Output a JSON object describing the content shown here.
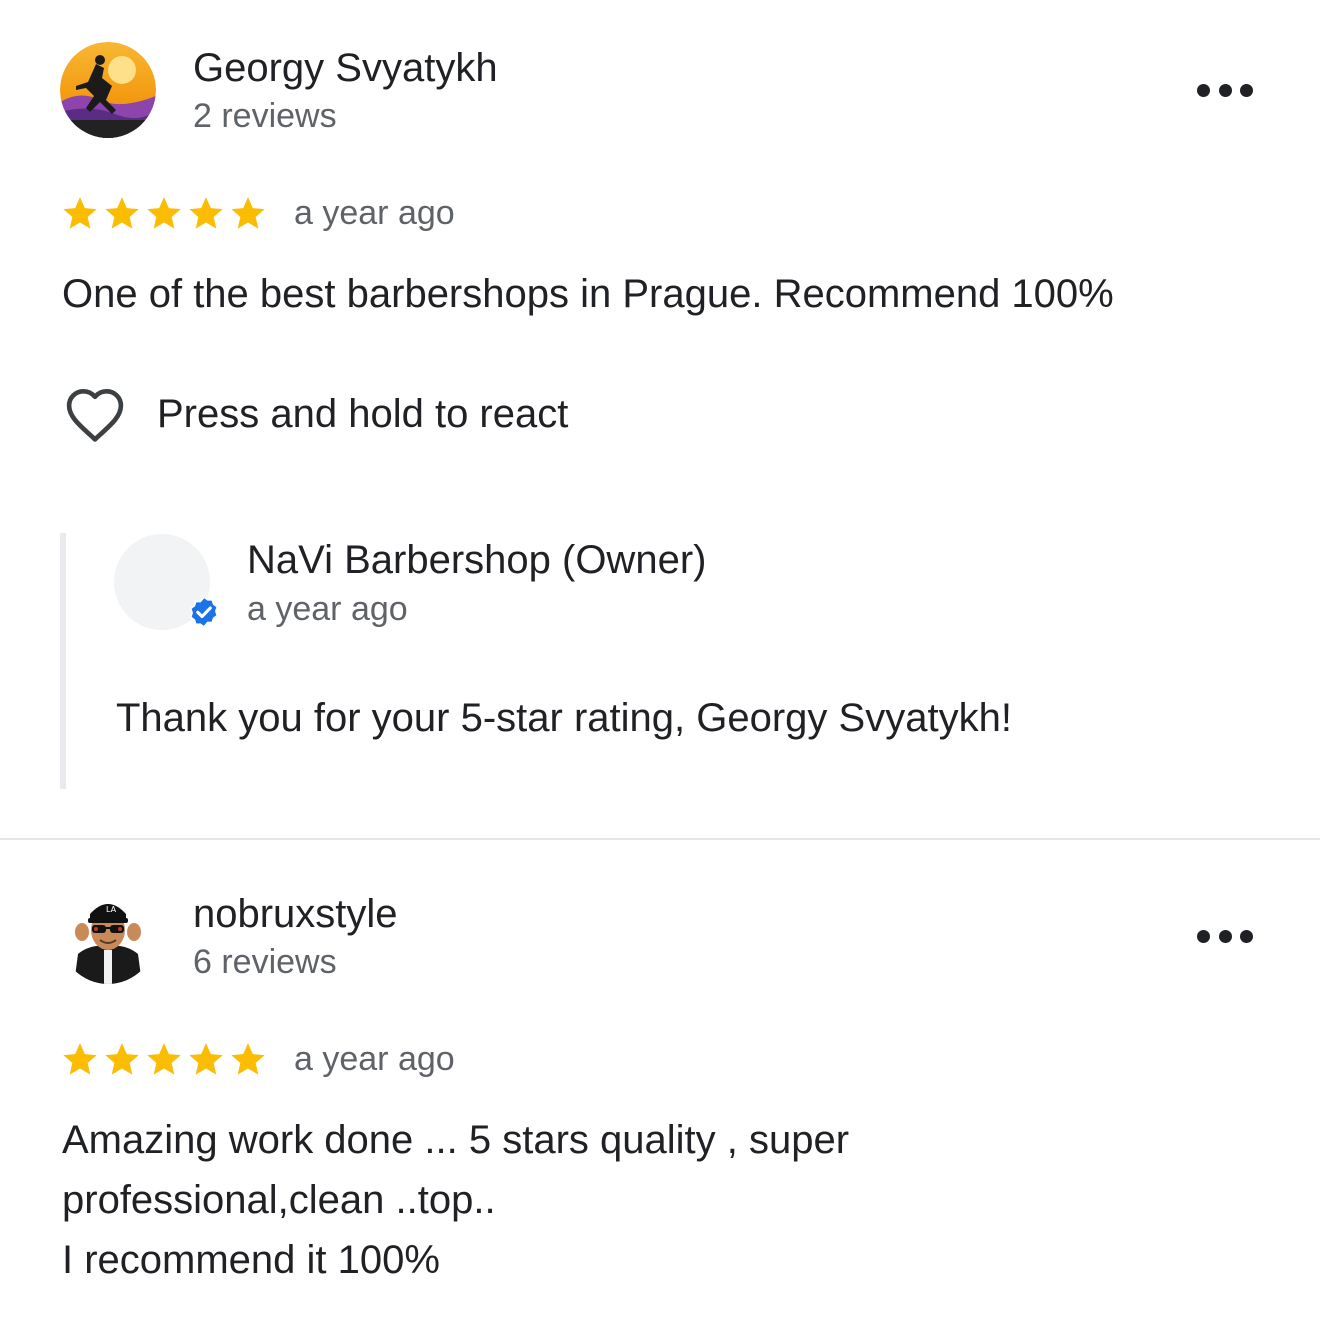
{
  "reviews": [
    {
      "author": "Georgy Svyatykh",
      "review_count": "2 reviews",
      "rating": 5,
      "time": "a year ago",
      "text": "One of the best barbershops in Prague. Recommend 100%",
      "react_label": "Press and hold to react",
      "owner_reply": {
        "name": "NaVi Barbershop (Owner)",
        "time": "a year ago",
        "text": "Thank you for your 5-star rating, Georgy Svyatykh!"
      }
    },
    {
      "author": "nobruxstyle",
      "review_count": "6 reviews",
      "rating": 5,
      "time": "a year ago",
      "text_lines": [
        "Amazing work done ... 5 stars quality , super",
        "professional,clean ..top..",
        "I recommend it 100%"
      ]
    }
  ],
  "icons": {
    "more": "more-horizontal-icon",
    "heart": "heart-outline-icon",
    "star": "star-icon",
    "verified": "verified-badge-icon"
  },
  "colors": {
    "star": "#fbbc04",
    "verified": "#1a73e8",
    "text": "#202124",
    "secondary": "#5f6368"
  }
}
